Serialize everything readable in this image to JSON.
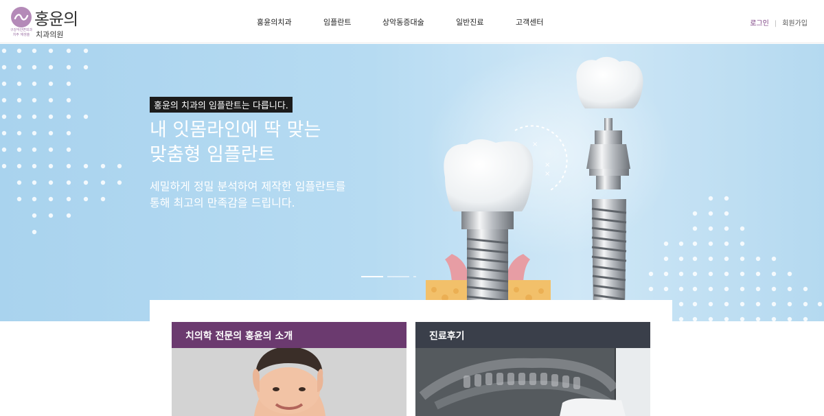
{
  "logo": {
    "title": "홍윤의",
    "subtitle": "치과의원",
    "tagline": "구강악안면외과 치주 재생술",
    "mark_color": "#b48ab8"
  },
  "nav": {
    "items": [
      "홍윤의치과",
      "임플란트",
      "상악동증대술",
      "일반진료",
      "고객센터"
    ]
  },
  "util": {
    "login": "로그인",
    "separator": "|",
    "join": "회원가입"
  },
  "hero": {
    "badge": "홍윤의 치과의 임플란트는 다릅니다.",
    "title_line1": "내 잇몸라인에 딱 맞는",
    "title_line2": "맞춤형 임플란트",
    "desc_line1": "세밀하게 정밀 분석하여 제작한 임플란트를",
    "desc_line2": "통해 최고의 만족감을 드립니다.",
    "slide_count": 3,
    "active_slide": 1
  },
  "cards": {
    "intro_title": "치의학 전문의 홍윤의 소개",
    "review_title": "진료후기"
  },
  "colors": {
    "accent": "#7a3d80",
    "intro_header": "#6b3a6f",
    "review_header": "#3a3f4a",
    "hero_bg": "#b6dbf2"
  },
  "icons": [
    "logo-mark-icon",
    "implant-illustration",
    "dot-pattern"
  ]
}
